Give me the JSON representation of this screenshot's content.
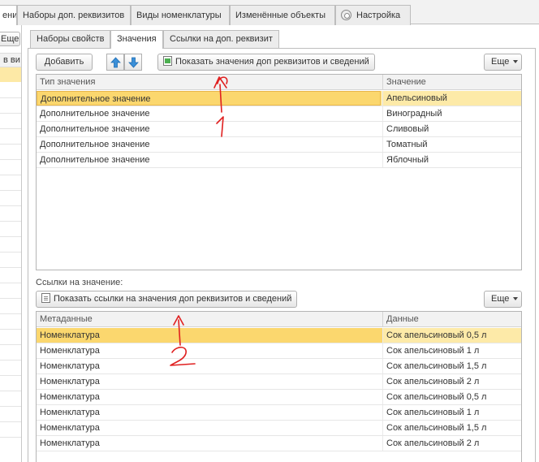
{
  "top_tabs": [
    {
      "label": "ения"
    },
    {
      "label": "Наборы доп. реквизитов"
    },
    {
      "label": "Виды номенклатуры"
    },
    {
      "label": "Изменённые объекты"
    },
    {
      "label": "Настройка"
    }
  ],
  "left_panel": {
    "more_label": "Еще",
    "column_header_fragment": "в ви"
  },
  "inner_tabs": [
    {
      "label": "Наборы свойств"
    },
    {
      "label": "Значения"
    },
    {
      "label": "Ссылки на доп. реквизит"
    }
  ],
  "toolbar": {
    "add_label": "Добавить",
    "show_values_label": "Показать значения доп реквизитов и сведений",
    "more_label": "Еще"
  },
  "values_table": {
    "columns": [
      "Тип значения",
      "Значение"
    ],
    "rows": [
      [
        "Дополнительное значение",
        "Апельсиновый"
      ],
      [
        "Дополнительное значение",
        "Виноградный"
      ],
      [
        "Дополнительное значение",
        "Сливовый"
      ],
      [
        "Дополнительное значение",
        "Томатный"
      ],
      [
        "Дополнительное значение",
        "Яблочный"
      ]
    ],
    "selected_row": 0
  },
  "refs_section": {
    "label": "Ссылки на значение:",
    "show_refs_label": "Показать ссылки на значения доп реквизитов и сведений",
    "more_label": "Еще"
  },
  "refs_table": {
    "columns": [
      "Метаданные",
      "Данные"
    ],
    "rows": [
      [
        "Номенклатура",
        "Сок апельсиновый 0,5 л"
      ],
      [
        "Номенклатура",
        "Сок апельсиновый 1 л"
      ],
      [
        "Номенклатура",
        "Сок апельсиновый 1,5 л"
      ],
      [
        "Номенклатура",
        "Сок апельсиновый 2 л"
      ],
      [
        "Номенклатура",
        "Сок апельсиновый 0,5 л"
      ],
      [
        "Номенклатура",
        "Сок апельсиновый 1 л"
      ],
      [
        "Номенклатура",
        "Сок апельсиновый 1,5 л"
      ],
      [
        "Номенклатура",
        "Сок апельсиновый 2 л"
      ]
    ],
    "selected_row": 0
  },
  "annotations": {
    "color": "#e02020",
    "mark_1": "1",
    "mark_2": "2"
  },
  "colors": {
    "selected_row": "#fdeaa8",
    "selected_cell": "#fbd76e",
    "arrow_blue": "#3a8fd8"
  }
}
